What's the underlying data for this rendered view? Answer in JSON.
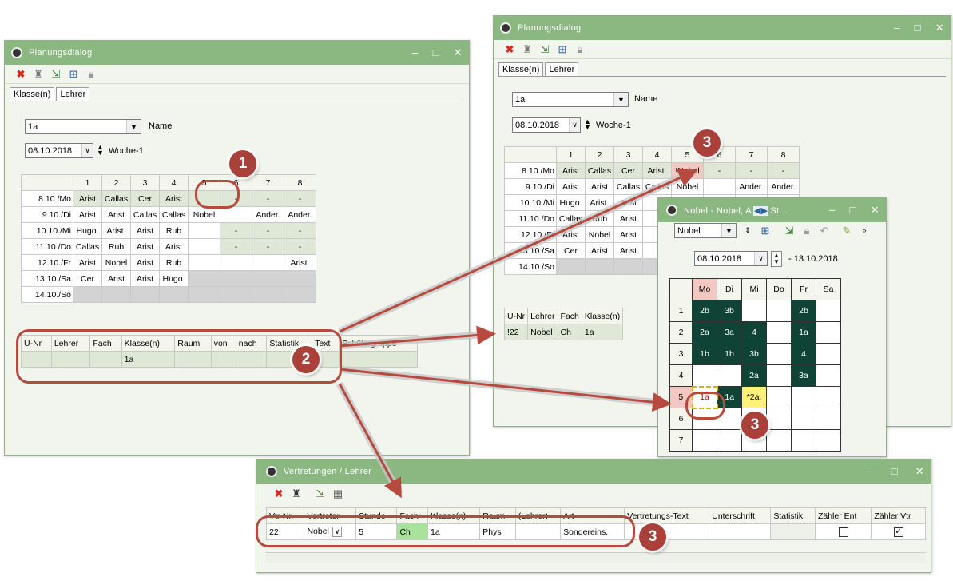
{
  "left_dialog": {
    "title": "Planungsdialog",
    "tabs": [
      "Klasse(n)",
      "Lehrer"
    ],
    "class_value": "1a",
    "name_label": "Name",
    "date_value": "08.10.2018",
    "week_label": "Woche-1",
    "grid": {
      "headers": [
        "",
        "1",
        "2",
        "3",
        "4",
        "5",
        "6",
        "7",
        "8"
      ],
      "rows": [
        [
          "8.10./Mo",
          "Arist",
          "Callas",
          "Cer",
          "Arist",
          "",
          "-",
          "-",
          "-"
        ],
        [
          "9.10./Di",
          "Arist",
          "Arist",
          "Callas",
          "Callas",
          "Nobel",
          "",
          "Ander.",
          "Ander."
        ],
        [
          "10.10./Mi",
          "Hugo.",
          "Arist.",
          "Arist",
          "Rub",
          "",
          "-",
          "-",
          "-"
        ],
        [
          "11.10./Do",
          "Callas",
          "Rub",
          "Arist",
          "Arist",
          "",
          "-",
          "-",
          "-"
        ],
        [
          "12.10./Fr",
          "Arist",
          "Nobel",
          "Arist",
          "Rub",
          "",
          "",
          "",
          "Arist."
        ],
        [
          "13.10./Sa",
          "Cer",
          "Arist",
          "Arist",
          "Hugo.",
          "",
          "",
          "",
          ""
        ],
        [
          "14.10./So",
          "",
          "",
          "",
          "",
          "",
          "",
          "",
          ""
        ]
      ]
    },
    "list_headers": [
      "U-Nr",
      "Lehrer",
      "Fach",
      "Klasse(n)",
      "Raum",
      "von",
      "nach",
      "Statistik",
      "Text",
      "Schülergruppe"
    ],
    "list_row": [
      "",
      "",
      "",
      "1a",
      "",
      "",
      "",
      "",
      "",
      ""
    ]
  },
  "right_dialog": {
    "title": "Planungsdialog",
    "tabs": [
      "Klasse(n)",
      "Lehrer"
    ],
    "class_value": "1a",
    "name_label": "Name",
    "date_value": "08.10.2018",
    "week_label": "Woche-1",
    "grid": {
      "headers": [
        "",
        "1",
        "2",
        "3",
        "4",
        "5",
        "6",
        "7",
        "8"
      ],
      "rows": [
        [
          "8.10./Mo",
          "Arist",
          "Callas",
          "Cer",
          "Arist.",
          "!Nobel",
          "-",
          "-",
          "-"
        ],
        [
          "9.10./Di",
          "Arist",
          "Arist",
          "Callas",
          "Callas",
          "Nobel",
          "",
          "Ander.",
          "Ander."
        ],
        [
          "10.10./Mi",
          "Hugo.",
          "Arist.",
          "Arist",
          "",
          "",
          "",
          "",
          ""
        ],
        [
          "11.10./Do",
          "Callas",
          "Rub",
          "Arist",
          "",
          "",
          "",
          "",
          ""
        ],
        [
          "12.10./Fr",
          "Arist",
          "Nobel",
          "Arist",
          "",
          "",
          "",
          "",
          ""
        ],
        [
          "13.10./Sa",
          "Cer",
          "Arist",
          "Arist",
          "",
          "",
          "",
          "",
          ""
        ],
        [
          "14.10./So",
          "",
          "",
          "",
          "",
          "",
          "",
          "",
          ""
        ]
      ]
    },
    "list_headers": [
      "U-Nr",
      "Lehrer",
      "Fach",
      "Klasse(n)"
    ],
    "list_row": [
      "!22",
      "Nobel",
      "Ch",
      "1a"
    ]
  },
  "nobel_window": {
    "title": "Nobel - Nobel, A",
    "title_tail": "St...",
    "teacher_value": "Nobel",
    "date_value": "08.10.2018",
    "date_end": "- 13.10.2018",
    "days": [
      "Mo",
      "Di",
      "Mi",
      "Do",
      "Fr",
      "Sa"
    ],
    "rows": [
      {
        "n": "1",
        "cells": [
          "2b",
          "3b",
          "",
          "",
          "2b",
          ""
        ]
      },
      {
        "n": "2",
        "cells": [
          "2a",
          "3a",
          "4",
          "",
          "1a",
          ""
        ]
      },
      {
        "n": "3",
        "cells": [
          "1b",
          "1b",
          "3b",
          "",
          "4",
          ""
        ]
      },
      {
        "n": "4",
        "cells": [
          "",
          "",
          "2a",
          "",
          "3a",
          ""
        ]
      },
      {
        "n": "5",
        "cells": [
          "1a",
          "1a",
          "*2a.",
          "",
          "",
          ""
        ]
      },
      {
        "n": "6",
        "cells": [
          "",
          "",
          "",
          "",
          "",
          ""
        ]
      },
      {
        "n": "7",
        "cells": [
          "",
          "",
          "",
          "",
          "",
          ""
        ]
      }
    ]
  },
  "vertretungen": {
    "title": "Vertretungen / Lehrer",
    "headers": [
      "Vtr-Nr.",
      "Vertreter",
      "Stunde",
      "Fach",
      "Klasse(n)",
      "Raum",
      "(Lehrer)",
      "Art",
      "Vertretungs-Text",
      "Unterschrift",
      "Statistik",
      "Zähler Ent",
      "Zähler Vtr"
    ],
    "row": [
      "22",
      "Nobel",
      "5",
      "Ch",
      "1a",
      "Phys",
      "",
      "Sondereins.",
      "",
      "",
      "",
      "",
      ""
    ],
    "zaehler_ent_checked": false,
    "zaehler_vtr_checked": true
  },
  "markers": [
    "1",
    "2",
    "3",
    "3",
    "3"
  ],
  "colors": {
    "titlebar": "#8bb780",
    "marker": "#a9403a",
    "schedule_dark": "#0e4335"
  }
}
